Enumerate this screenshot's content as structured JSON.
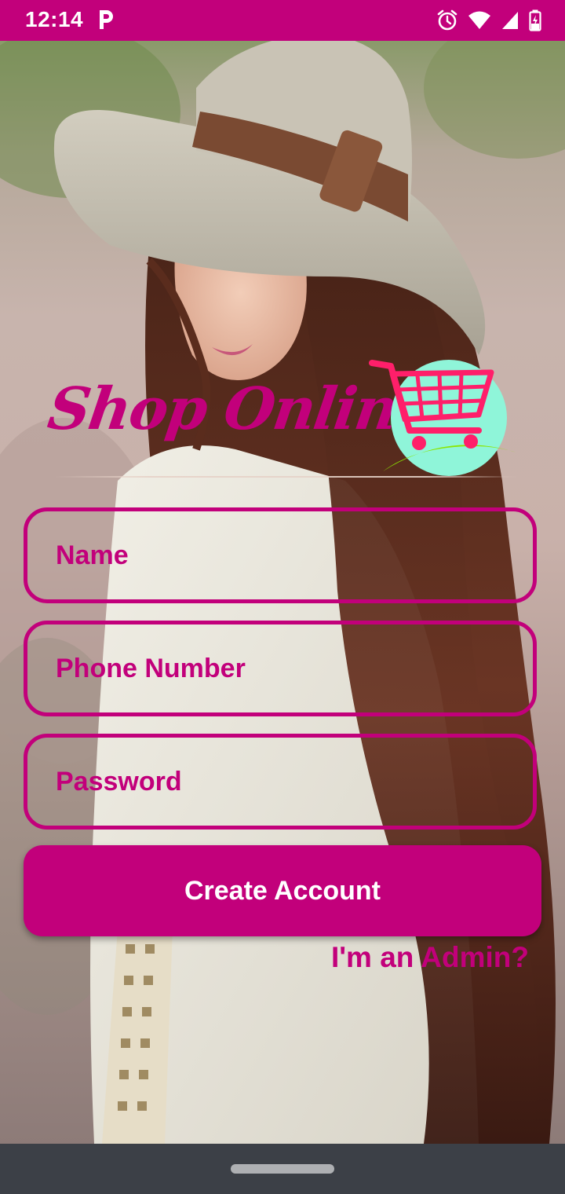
{
  "status_bar": {
    "time": "12:14",
    "icons": [
      "p-app-icon",
      "alarm-icon",
      "wifi-icon",
      "signal-icon",
      "battery-icon"
    ]
  },
  "background": {
    "image": "woman-in-hat-photo"
  },
  "logo": {
    "text": "Shop Online",
    "icon": "shopping-cart-icon"
  },
  "form": {
    "name_placeholder": "Name",
    "phone_placeholder": "Phone Number",
    "password_placeholder": "Password",
    "name_value": "",
    "phone_value": "",
    "password_value": ""
  },
  "actions": {
    "create_account_label": "Create Account",
    "admin_link_label": "I'm an Admin?"
  },
  "colors": {
    "accent": "#c2007b",
    "status_bar": "#c2007b",
    "nav_bar": "#3c4047",
    "cart_circle": "#8ff5d9",
    "cart_swoosh": "#8be600",
    "cart_red": "#ff1f6a"
  }
}
